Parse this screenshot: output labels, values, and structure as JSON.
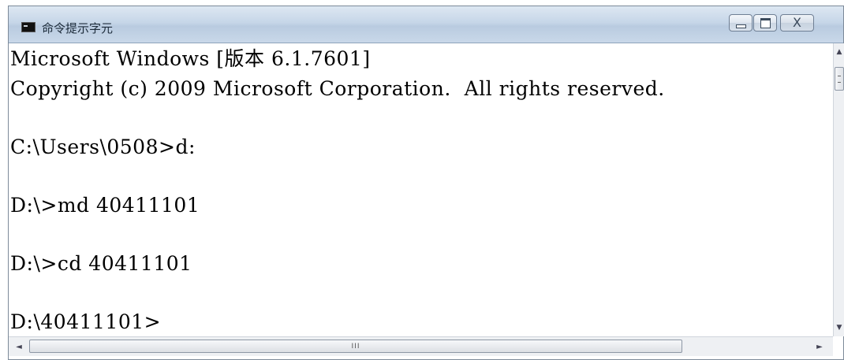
{
  "window": {
    "title": "命令提示字元",
    "icon": "cmd-icon",
    "controls": {
      "minimize_icon": "minimize-icon",
      "maximize_icon": "maximize-icon",
      "close_glyph": "X"
    }
  },
  "console": {
    "lines": [
      "Microsoft Windows [版本 6.1.7601]",
      "Copyright (c) 2009 Microsoft Corporation.  All rights reserved.",
      "C:\\Users\\0508>d:",
      "D:\\>md 40411101",
      "D:\\>cd 40411101",
      "D:\\40411101>"
    ]
  },
  "scrollbars": {
    "up_arrow": "▲",
    "down_arrow": "▼",
    "left_arrow": "◄",
    "right_arrow": "►",
    "h_thumb_grip": "III"
  },
  "colors": {
    "console_bg": "#ffffff",
    "console_text": "#000000",
    "titlebar": "#c6d6e8"
  }
}
